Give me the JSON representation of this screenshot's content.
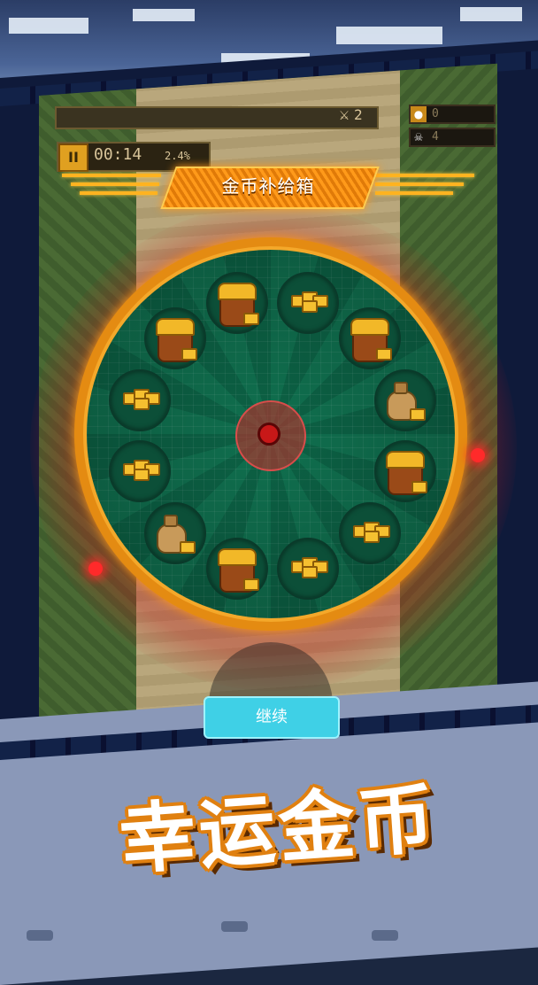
{
  "hud": {
    "kill_count": "2",
    "coins": "0",
    "skulls": "4",
    "timer": "00:14",
    "progress": "2.4%",
    "pause_label": "II"
  },
  "dialog": {
    "title": "金币补给箱",
    "continue_label": "继续"
  },
  "wheel": {
    "slots": [
      {
        "icon": "gold-bucket-icon"
      },
      {
        "icon": "gold-bars-icon"
      },
      {
        "icon": "gold-bucket-icon"
      },
      {
        "icon": "gold-sack-icon"
      },
      {
        "icon": "gold-bucket-icon"
      },
      {
        "icon": "gold-bars-icon"
      },
      {
        "icon": "gold-bars-icon"
      },
      {
        "icon": "gold-bucket-icon"
      },
      {
        "icon": "gold-sack-icon"
      },
      {
        "icon": "gold-bars-icon"
      },
      {
        "icon": "gold-bars-icon"
      },
      {
        "icon": "gold-bucket-icon"
      }
    ]
  },
  "banner": {
    "text": "幸运金币"
  },
  "colors": {
    "accent": "#ff9a1a",
    "wheel_green": "#10704f",
    "button_cyan": "#3fd0e6"
  }
}
